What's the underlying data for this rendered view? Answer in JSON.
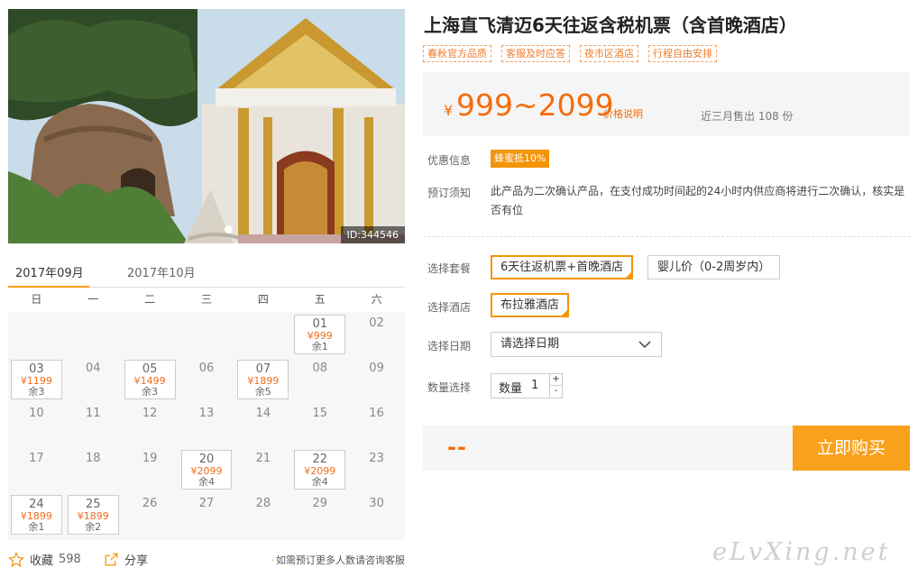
{
  "photo": {
    "id_label": "ID:344546",
    "dots": 2
  },
  "calendar": {
    "tabs": [
      "2017年09月",
      "2017年10月"
    ],
    "weekdays": [
      "日",
      "一",
      "二",
      "三",
      "四",
      "五",
      "六"
    ],
    "leading_blanks": 5,
    "days": [
      {
        "day": "01",
        "price": "¥999",
        "left": "余1"
      },
      {
        "day": "02"
      },
      {
        "day": "03",
        "price": "¥1199",
        "left": "余3"
      },
      {
        "day": "04"
      },
      {
        "day": "05",
        "price": "¥1499",
        "left": "余3"
      },
      {
        "day": "06"
      },
      {
        "day": "07",
        "price": "¥1899",
        "left": "余5"
      },
      {
        "day": "08"
      },
      {
        "day": "09"
      },
      {
        "day": "10"
      },
      {
        "day": "11"
      },
      {
        "day": "12"
      },
      {
        "day": "13"
      },
      {
        "day": "14"
      },
      {
        "day": "15"
      },
      {
        "day": "16"
      },
      {
        "day": "17"
      },
      {
        "day": "18"
      },
      {
        "day": "19"
      },
      {
        "day": "20",
        "price": "¥2099",
        "left": "余4"
      },
      {
        "day": "21"
      },
      {
        "day": "22",
        "price": "¥2099",
        "left": "余4"
      },
      {
        "day": "23"
      },
      {
        "day": "24",
        "price": "¥1899",
        "left": "余1"
      },
      {
        "day": "25",
        "price": "¥1899",
        "left": "余2"
      },
      {
        "day": "26"
      },
      {
        "day": "27"
      },
      {
        "day": "28"
      },
      {
        "day": "29"
      },
      {
        "day": "30"
      }
    ]
  },
  "actions": {
    "favorite_label": "收藏",
    "favorite_count": "598",
    "share_label": "分享",
    "note": "如需预订更多人数请咨询客服"
  },
  "product": {
    "title": "上海直飞清迈6天往返含税机票（含首晚酒店）",
    "tags": [
      "春秋官方品质",
      "客服及时应答",
      "夜市区酒店",
      "行程自由安排"
    ],
    "currency": "¥",
    "price_range": "999~2099",
    "price_explain": "价格说明",
    "sold": "近三月售出 108 份"
  },
  "info": {
    "promo_label": "优惠信息",
    "promo_badge": "蜂蜜抵10%",
    "notice_label": "预订须知",
    "notice_text": "此产品为二次确认产品，在支付成功时间起的24小时内供应商将进行二次确认，核实是否有位"
  },
  "selection": {
    "package_label": "选择套餐",
    "packages": [
      "6天往返机票+首晚酒店",
      "婴儿价（0-2周岁内）"
    ],
    "hotel_label": "选择酒店",
    "hotel": "布拉雅酒店",
    "date_label": "选择日期",
    "date_placeholder": "请选择日期",
    "qty_label_row": "数量选择",
    "qty_label": "数量",
    "qty_value": "1",
    "qty_plus": "+",
    "qty_minus": "-"
  },
  "buy": {
    "total": "--",
    "button": "立即购买"
  },
  "watermark": "eLvXing.net",
  "colors": {
    "accent": "#f49409",
    "price": "#f46c0c",
    "button": "#f9a11b"
  }
}
